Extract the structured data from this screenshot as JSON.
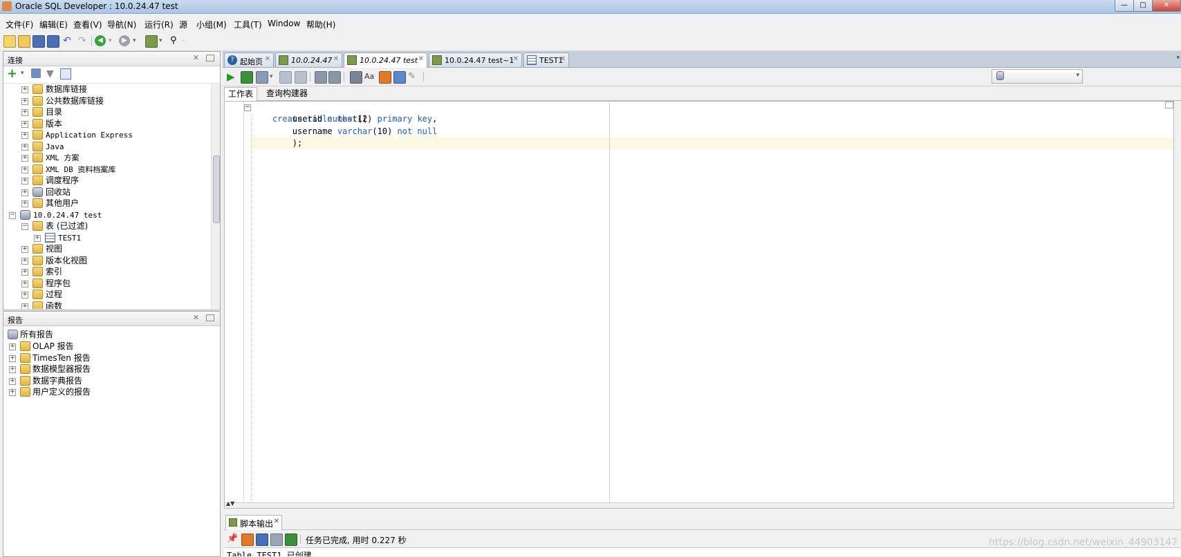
{
  "window": {
    "title": "Oracle SQL Developer : 10.0.24.47 test"
  },
  "menu": [
    "文件(F)",
    "编辑(E)",
    "查看(V)",
    "导航(N)",
    "运行(R)",
    "源",
    "小组(M)",
    "工具(T)",
    "Window",
    "帮助(H)"
  ],
  "connections_panel": {
    "title": "连接",
    "tree": [
      {
        "label": "数据库链接",
        "icon": "folder-icon",
        "expander": "+"
      },
      {
        "label": "公共数据库链接",
        "icon": "folder-icon",
        "expander": "+"
      },
      {
        "label": "目录",
        "icon": "folder-icon",
        "expander": "+"
      },
      {
        "label": "版本",
        "icon": "folder-icon",
        "expander": "+"
      },
      {
        "label": "Application Express",
        "icon": "folder-icon",
        "expander": "+"
      },
      {
        "label": "Java",
        "icon": "folder-icon",
        "expander": "+"
      },
      {
        "label": "XML 方案",
        "icon": "folder-icon",
        "expander": "+"
      },
      {
        "label": "XML DB 资料档案库",
        "icon": "folder-icon",
        "expander": "+"
      },
      {
        "label": "调度程序",
        "icon": "folder-icon",
        "expander": "+"
      },
      {
        "label": "回收站",
        "icon": "recycle-bin-icon",
        "expander": "+"
      },
      {
        "label": "其他用户",
        "icon": "folder-icon",
        "expander": "+"
      },
      {
        "label": "10.0.24.47 test",
        "icon": "database-connection-icon",
        "expander": "−"
      },
      {
        "label": "表 (已过滤)",
        "icon": "folder-icon",
        "expander": "−"
      },
      {
        "label": "TEST1",
        "icon": "table-icon",
        "expander": "+"
      },
      {
        "label": "视图",
        "icon": "folder-icon",
        "expander": "+"
      },
      {
        "label": "版本化视图",
        "icon": "folder-icon",
        "expander": "+"
      },
      {
        "label": "索引",
        "icon": "folder-icon",
        "expander": "+"
      },
      {
        "label": "程序包",
        "icon": "folder-icon",
        "expander": "+"
      },
      {
        "label": "过程",
        "icon": "folder-icon",
        "expander": "+"
      },
      {
        "label": "函数",
        "icon": "folder-icon",
        "expander": "+"
      }
    ]
  },
  "reports_panel": {
    "title": "报告",
    "root": "所有报告",
    "items": [
      "OLAP 报告",
      "TimesTen 报告",
      "数据模型器报告",
      "数据字典报告",
      "用户定义的报告"
    ]
  },
  "doc_tabs": [
    {
      "label": "起始页"
    },
    {
      "label": "10.0.24.47"
    },
    {
      "label": "10.0.24.47 test"
    },
    {
      "label": "10.0.24.47 test~1"
    },
    {
      "label": "TEST1"
    }
  ],
  "editor_subtabs": [
    "工作表",
    "查询构建器"
  ],
  "editor": {
    "lines": [
      "create table test1(",
      "        userid number(2) primary key,",
      "        username varchar(10) not null",
      "        );"
    ]
  },
  "output": {
    "tab_label": "脚本输出",
    "status": "任务已完成, 用时 0.227 秒",
    "text": "Table TEST1 已创建。"
  },
  "watermark": "https://blog.csdn.net/weixin_44903147"
}
